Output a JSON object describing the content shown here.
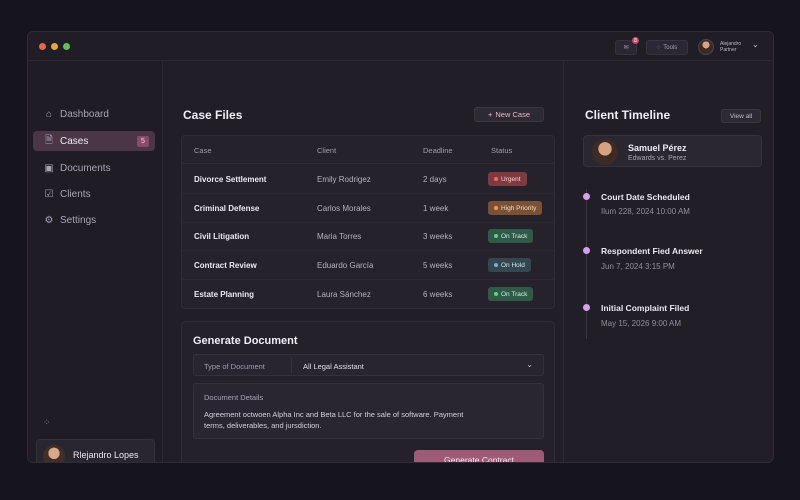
{
  "titlebar": {
    "notif_count": "8",
    "tools_label": "Tools",
    "user_line1": "Alejandro",
    "user_line2": "Partner"
  },
  "sidebar": {
    "items": [
      {
        "label": "Dashboard",
        "icon": "home-icon"
      },
      {
        "label": "Cases",
        "icon": "case-file-icon",
        "count": "5",
        "active": true
      },
      {
        "label": "Documents",
        "icon": "document-icon"
      },
      {
        "label": "Clients",
        "icon": "clients-icon"
      },
      {
        "label": "Settings",
        "icon": "settings-icon"
      }
    ],
    "user_name": "Rlejandro Lopes"
  },
  "case_files": {
    "title": "Case Files",
    "new_case_label": "New Case",
    "columns": [
      "Case",
      "Client",
      "Deadline",
      "Status"
    ],
    "rows": [
      {
        "case": "Divorce Settlement",
        "client": "Emily Rodrigez",
        "deadline": "2 days",
        "status": "Urgent",
        "status_color": "#7e3a3f"
      },
      {
        "case": "Criminal Defense",
        "client": "Carlos Morales",
        "deadline": "1 week",
        "status": "High Priority",
        "status_color": "#7a5135"
      },
      {
        "case": "Civil Litigation",
        "client": "Maria Torres",
        "deadline": "3 weeks",
        "status": "On Track",
        "status_color": "#2f5a47"
      },
      {
        "case": "Contract Review",
        "client": "Eduardo García",
        "deadline": "5 weeks",
        "status": "On Hold",
        "status_color": "#34464f"
      },
      {
        "case": "Estate Planning",
        "client": "Laura Sánchez",
        "deadline": "6 weeks",
        "status": "On Track",
        "status_color": "#2f5a47"
      }
    ]
  },
  "generate": {
    "title": "Generate Document",
    "type_label": "Type of Document",
    "type_value": "All Legal Assistant",
    "details_label": "Document Details",
    "details_text": "Agreement octwoen Alpha Inc and Beta LLC for the sale of software. Payment terms, deliverables, and jursdiction.",
    "button_label": "Generate Contract"
  },
  "timeline": {
    "title": "Client Timeline",
    "view_all_label": "View all",
    "client_name": "Samuel Pérez",
    "client_case": "Edwards vs. Perez",
    "events": [
      {
        "title": "Court Date Scheduled",
        "date": "Ilum 228, 2024 10:00 AM"
      },
      {
        "title": "Respondent Fied Answer",
        "date": "Jun 7, 2024 3:15 PM"
      },
      {
        "title": "Initial Complaint Filed",
        "date": "May 15, 2026 9:00 AM"
      }
    ]
  },
  "colors": {
    "accent": "#9e5b78",
    "background": "#16141c",
    "panel": "#211e27"
  }
}
